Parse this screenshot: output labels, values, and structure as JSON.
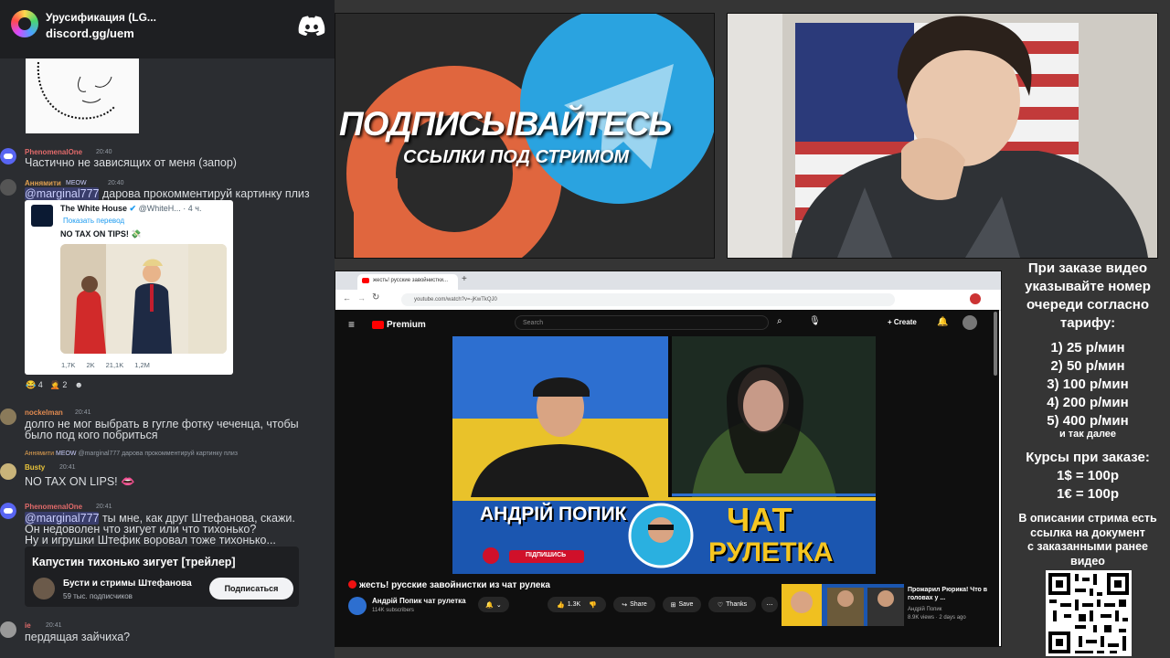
{
  "discord": {
    "server_name": "Урусификация (LG...",
    "invite_link": "discord.gg/uem",
    "messages": [
      {
        "user": "PhenomenalOne",
        "time": "20:40",
        "text": "Частично не зависящих от меня (запор)",
        "name_color": "#e06a6a"
      },
      {
        "user": "Аннямити",
        "tag": "MEOW",
        "time": "20:40",
        "mention": "@marginal777",
        "text": " дарова прокомментируй картинку плиз",
        "name_color": "#e0a050"
      },
      {
        "user": "nockelman",
        "time": "20:41",
        "text_lines": [
          "долго не мог выбрать в гугле фотку чеченца, чтобы",
          "было под кого побриться"
        ],
        "name_color": "#e08a50"
      },
      {
        "reply_user": "Аннямити",
        "reply_tag": "MEOW",
        "reply_text": "@marginal777 дарова прокомментируй картинку плиз"
      },
      {
        "user": "Busty",
        "time": "20:41",
        "text": "NO TAX ON LIPS! 👄",
        "name_color": "#e8c33a"
      },
      {
        "user": "PhenomenalOne",
        "time": "20:41",
        "mention": "@marginal777",
        "text": " ты мне, как друг Штефанова, скажи.",
        "extra_lines": [
          "Он недоволен что зигует или что тихонько?",
          "Ну и игрушки Штефик воровал тоже тихонько..."
        ],
        "name_color": "#e06a6a"
      },
      {
        "user": "ie",
        "time": "20:41",
        "text": "пердящая зайчиха?",
        "name_color": "#e06a6a"
      }
    ],
    "tweet": {
      "author": "The White House",
      "handle": "@WhiteH...",
      "age": "· 4 ч.",
      "translate": "Показать перевод",
      "text": "NO TAX ON TIPS! 💸",
      "stats": [
        "1,7K",
        "2K",
        "21,1K",
        "1,2M"
      ]
    },
    "reactions": [
      "😂 4",
      "🤦 2",
      "☻"
    ],
    "embed": {
      "title": "Капустин тихонько зигует [трейлер]",
      "channel": "Бусти и стримы Штефанова",
      "subscribers": "59 тыс. подписчиков",
      "button": "Подписаться"
    }
  },
  "promo": {
    "line1": "ПОДПИСЫВАЙТЕСЬ",
    "line2": "ССЫЛКИ ПОД СТРИМОМ"
  },
  "browser": {
    "tab_title": "жесть! русские завойнистки...",
    "url": "youtube.com/watch?v=-jKwTkQJ0",
    "youtube": {
      "brand": "Premium",
      "search_placeholder": "Search",
      "create_label": "Create",
      "banner_name": "АНДРІЙ ПОПИК",
      "banner_subscribe": "ПІДПИШИСЬ",
      "banner_chat": "ЧАТ",
      "banner_roulette": "РУЛЕТКА",
      "video_title": "жесть! русские завойнистки из чат рулека",
      "channel": "Андрій Попик чат рулетка",
      "subs": "114K subscribers",
      "likes": "1.3K",
      "share": "Share",
      "save": "Save",
      "thanks": "Thanks",
      "side": {
        "title": "Прожарил Рюрика! Что в головах у ...",
        "channel": "Андрій Попик",
        "meta": "8.9K views · 2 days ago"
      }
    }
  },
  "info": {
    "intro": [
      "При заказе видео",
      "указывайте номер",
      "очереди согласно",
      "тарифу:"
    ],
    "tariffs": [
      "1) 25 р/мин",
      "2) 50 р/мин",
      "3) 100 р/мин",
      "4) 200 р/мин",
      "5) 400 р/мин"
    ],
    "etc": "и так далее",
    "courses_title": "Курсы при заказе:",
    "rates": [
      "1$ = 100р",
      "1€ = 100р"
    ],
    "desc": [
      "В описании стрима есть",
      "ссылка на документ",
      "с заказанными ранее",
      "видео"
    ]
  }
}
